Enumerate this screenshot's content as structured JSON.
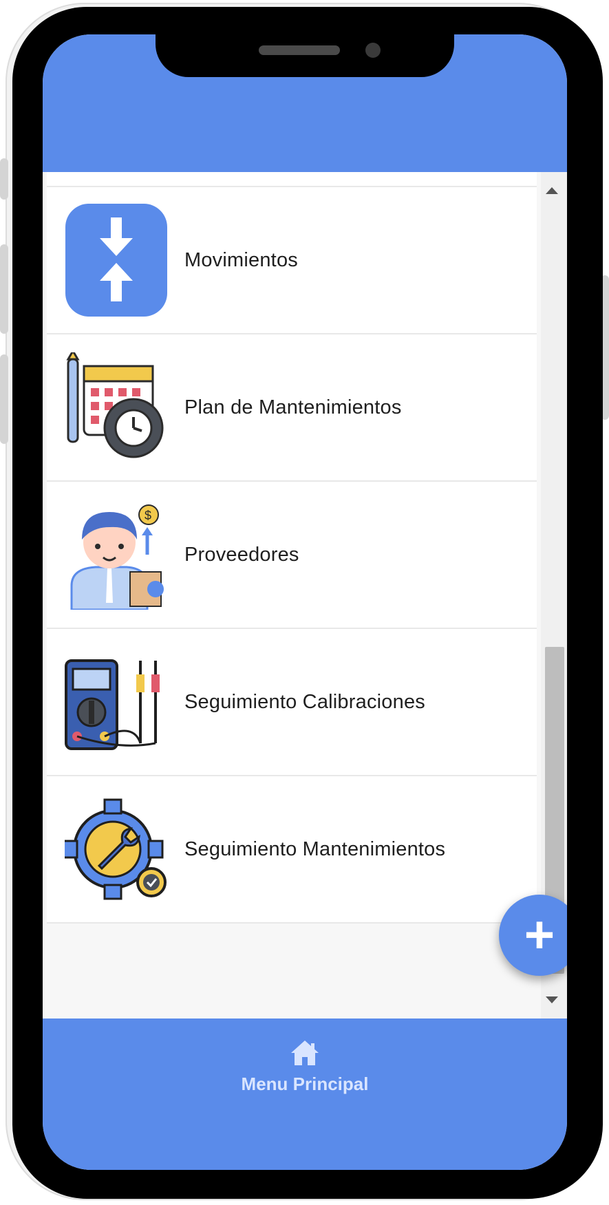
{
  "colors": {
    "primary": "#5a8bea",
    "row_background": "#ffffff",
    "text": "#1f1f1f",
    "footer_text": "#d9e5ff"
  },
  "menu": {
    "items": [
      {
        "label": "Movimientos",
        "icon": "up-down-arrows-icon"
      },
      {
        "label": "Plan de Mantenimientos",
        "icon": "calendar-gear-icon"
      },
      {
        "label": "Proveedores",
        "icon": "supplier-person-icon"
      },
      {
        "label": "Seguimiento Calibraciones",
        "icon": "multimeter-icon"
      },
      {
        "label": "Seguimiento Mantenimientos",
        "icon": "gear-wrench-icon"
      }
    ]
  },
  "fab": {
    "label": "+",
    "icon": "plus-icon"
  },
  "footer": {
    "nav": {
      "label": "Menu Principal",
      "icon": "home-icon"
    }
  }
}
